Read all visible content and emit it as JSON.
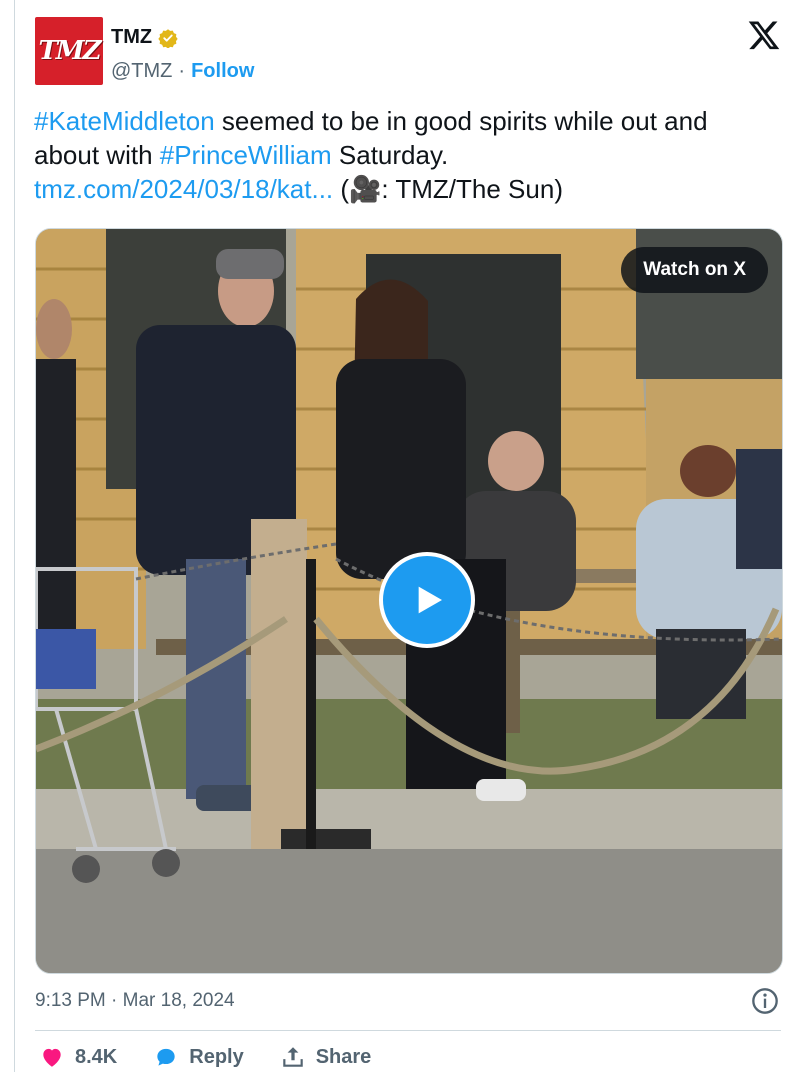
{
  "account": {
    "avatar_text": "TMZ",
    "name": "TMZ",
    "handle": "@TMZ",
    "separator": "·",
    "follow_label": "Follow"
  },
  "tweet": {
    "hashtag1": "#KateMiddleton",
    "text1": " seemed to be in good spirits while out and about with ",
    "hashtag2": "#PrinceWilliam",
    "text2": " Saturday.",
    "link": "tmz.com/2024/03/18/kat...",
    "credit": " (🎥: TMZ/The Sun)"
  },
  "media": {
    "watch_label": "Watch on X"
  },
  "footer": {
    "timestamp": "9:13 PM · Mar 18, 2024",
    "like_count": "8.4K",
    "reply_label": "Reply",
    "share_label": "Share"
  },
  "colors": {
    "accent": "#1d9bf0",
    "like": "#f91880",
    "tmz_red": "#d6202a",
    "verified_gold": "#e2b719"
  },
  "icons": [
    "verified-badge-icon",
    "x-logo-icon",
    "play-icon",
    "info-icon",
    "heart-icon",
    "reply-bubble-icon",
    "share-icon"
  ]
}
